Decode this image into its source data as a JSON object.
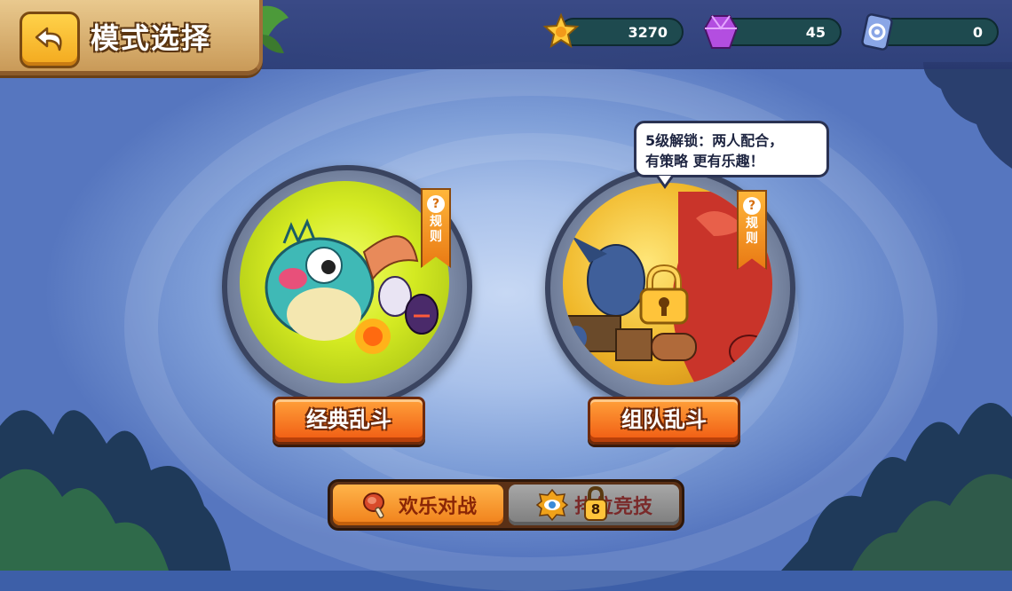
{
  "header": {
    "title": "模式选择",
    "back_icon": "back-arrow-icon"
  },
  "currencies": [
    {
      "icon": "star-coin-icon",
      "value": "3270",
      "color": "#ffc93a"
    },
    {
      "icon": "purple-gem-icon",
      "value": "45",
      "color": "#b34ee0"
    },
    {
      "icon": "swirl-card-icon",
      "value": "0",
      "color": "#6a8fd8"
    }
  ],
  "modes": [
    {
      "label": "经典乱斗",
      "rules_label": "规则",
      "rules_icon": "question-icon",
      "locked": false
    },
    {
      "label": "组队乱斗",
      "rules_label": "规则",
      "rules_icon": "question-icon",
      "locked": true
    }
  ],
  "locked_tooltip": {
    "line1": "5级解锁：两人配合，",
    "line2": "有策略 更有乐趣！"
  },
  "tabs": [
    {
      "label": "欢乐对战",
      "icon": "meat-icon",
      "active": true
    },
    {
      "label": "排位竞技",
      "icon": "eye-badge-icon",
      "active": false,
      "lock_level": "8"
    }
  ],
  "colors": {
    "accent_orange": "#f05a12",
    "tab_active": "#f0801a",
    "tab_locked": "#7d7d7d"
  }
}
